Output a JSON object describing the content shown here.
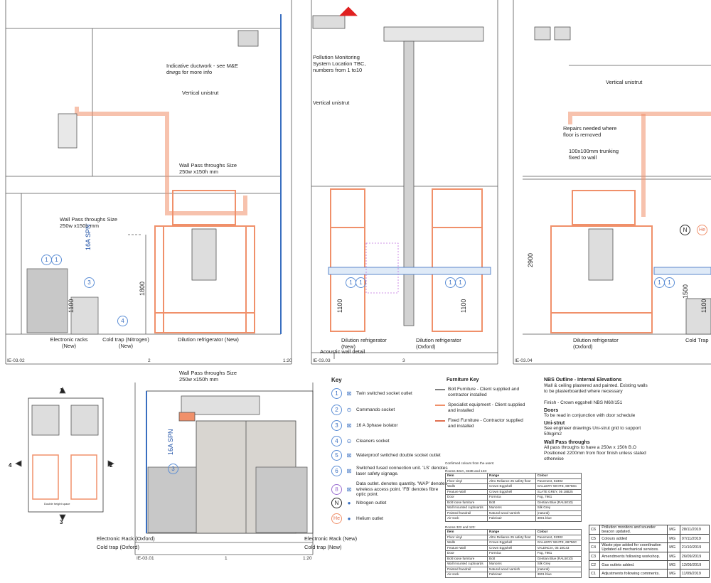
{
  "sheets": {
    "ie0302": {
      "ref": "IE-03.02",
      "num": "2",
      "scale": "1:20",
      "notes": {
        "ductwork": "Indicative ductwork - see M&E drwgs for more info",
        "unistrut": "Vertical unistrut",
        "wallpass_top": "Wall Pass throughs Size 250w x150h mm",
        "wallpass_left": "Wall Pass throughs Size 250w x150h mm"
      },
      "dims": {
        "d1100": "1100",
        "d1800": "1800"
      },
      "vlabel": "16A SPN",
      "labels": {
        "racks": "Electronic racks (New)",
        "coldtrap": "Cold trap (Nitrogen) (New)",
        "dilution": "Dilution refrigerator (New)"
      }
    },
    "ie0303": {
      "ref": "IE-03.03",
      "num": "3",
      "notes": {
        "pollution": "Pollution Monitoring System Location TBC, numbers from 1 to10",
        "unistrut": "Vertical unistrut"
      },
      "dims": {
        "d1100a": "1100",
        "d1100b": "1100"
      },
      "labels": {
        "dilution_new": "Dilution refrigerator (New)",
        "dilution_ox": "Dilution refrigerator (Oxford)",
        "acoustic": "Acoustic wall detail"
      }
    },
    "ie0304": {
      "ref": "IE-03.04",
      "notes": {
        "unistrut": "Vertical unistrut",
        "repairs": "Repairs needed where floor is removed",
        "trunking": "100x100mm trunking fixed to wall"
      },
      "dims": {
        "d2900": "2900",
        "d1500": "1500",
        "d1100": "1100"
      },
      "labels": {
        "dilution_ox": "Dilution refrigerator (Oxford)",
        "coldtrap": "Cold Trap"
      }
    },
    "ie0301": {
      "ref": "IE-03.01",
      "num": "1",
      "scale": "1:20",
      "notes": {
        "wallpass": "Wall Pass throughs Size 250w x150h mm"
      },
      "vlabel": "16A SPN",
      "labels": {
        "rack_ox": "Electronic Rack (Oxford)",
        "coldtrap_ox": "Cold trap (Oxford)",
        "rack_new": "Electronic Rack (New)",
        "coldtrap_new": "Cold trap (New)"
      }
    },
    "keyplan": {
      "n1": "1",
      "n2": "2",
      "n3": "3",
      "n4": "4",
      "hint": "Double height space"
    }
  },
  "key": {
    "title": "Key",
    "items": [
      {
        "num": "1",
        "sym": "⊠",
        "label": "Twin switched socket outlet"
      },
      {
        "num": "2",
        "sym": "⊙",
        "label": "Commando socket"
      },
      {
        "num": "3",
        "sym": "⊠",
        "label": "16 A 3phase isolator"
      },
      {
        "num": "4",
        "sym": "⊙",
        "label": "Cleaners socket"
      },
      {
        "num": "5",
        "sym": "⊠",
        "label": "Waterproof switched double socket outlet"
      },
      {
        "num": "6",
        "sym": "⊠",
        "label": "Switched fused connection unit. 'LS' denotes laser safety signage."
      },
      {
        "num": "8",
        "sym": "⊠",
        "label": "Data outlet. denotes quantity. 'WAP' denotes wireless access point. 'FB' denotes fibre optic point."
      },
      {
        "num": "N",
        "sym": "●",
        "label": "Nitrogen outlet"
      },
      {
        "num": "He",
        "sym": "●",
        "label": "Helium outlet"
      }
    ]
  },
  "furniture_key": {
    "title": "Furniture Key",
    "items": [
      {
        "label": "Bolt Furniture - Client supplied and contractor installed"
      },
      {
        "label": "Specialist equipment - Client supplied and installed"
      },
      {
        "label": "Fixed Furniture - Contractor supplied and installed"
      }
    ]
  },
  "nbs": {
    "title": "NBS Outline - Internal Elevations",
    "body": "Wall & ceiling plastered and painted. Existing walls to be plasterboarded where necessary",
    "finish": "Finish - Crown eggshell NBS M60/151",
    "doors_title": "Doors",
    "doors_body": "To be read in conjunction with door schedule",
    "unistrut_title": "Uni-strut",
    "unistrut_body": "See engineer drawings Uni-strut grid to support 50kg/m2",
    "wallpass_title": "Wall Pass throughs",
    "wallpass_body": "All pass throughs to have a 250w x 150h B.O Positioned 2200mm from floor finish unless stated otherwise"
  },
  "colours": {
    "intro": "Confirmed colours from the users:",
    "table1_title": "Rooms 322A, 322B and 123:",
    "table2_title": "Rooms 322 and 123:",
    "headers": [
      "Item",
      "Range",
      "Colour"
    ],
    "rows1": [
      [
        "Floor vinyl",
        "Altro Reliance 25 safety floor",
        "Pavement, 02302"
      ],
      [
        "Walls",
        "Crown Eggshell",
        "GALLERY WHITE, 69756C"
      ],
      [
        "Feature Wall",
        "Crown Eggshell",
        "SLATE GREY, 05 18B25"
      ],
      [
        "Door",
        "Formica",
        "Fog, 7961"
      ],
      [
        "Bolt loose furniture",
        "Bott",
        "Gentian Blue (RAL5010)"
      ],
      [
        "Wall mounted cupboards",
        "Manoms",
        "Silk Grey"
      ],
      [
        "Painted handrail",
        "Natural wood varnish",
        "(natural)"
      ],
      [
        "Air-sock",
        "Fabricair",
        "3001 blue"
      ]
    ],
    "rows2": [
      [
        "Floor vinyl",
        "Altro Reliance 25 safety floor",
        "Pavement, 02302"
      ],
      [
        "Walls",
        "Crown Eggshell",
        "GALLERY WHITE, 69756C"
      ],
      [
        "Feature Wall",
        "Crown Eggshell",
        "VALENCIA, 05 18C43"
      ],
      [
        "Door",
        "Formica",
        "Fog, 7961"
      ],
      [
        "Bolt loose furniture",
        "Bott",
        "Gentian Blue (RAL5010)"
      ],
      [
        "Wall mounted cupboards",
        "Manoms",
        "Silk Grey"
      ],
      [
        "Painted handrail",
        "Natural wood varnish",
        "(natural)"
      ],
      [
        "Air-sock",
        "Fabricair",
        "3001 blue"
      ]
    ]
  },
  "revisions": [
    {
      "rev": "C6",
      "desc": "Pollution monitors and sounder beacon updated.",
      "by": "MG",
      "date": "28/11/2019"
    },
    {
      "rev": "C5",
      "desc": "Colours added",
      "by": "MG",
      "date": "07/11/2019"
    },
    {
      "rev": "C4",
      "desc": "Waste pipe added for coordination Updated all mechanical services.",
      "by": "MG",
      "date": "21/10/2019"
    },
    {
      "rev": "C3",
      "desc": "Amendments following workshop.",
      "by": "MG",
      "date": "26/09/2019"
    },
    {
      "rev": "C2",
      "desc": "Gas outlets added.",
      "by": "MG",
      "date": "12/09/2019"
    },
    {
      "rev": "C1",
      "desc": "Adjustments following comments.",
      "by": "MG",
      "date": "11/09/2019"
    }
  ],
  "colors": {
    "orange": "#f0906a",
    "blue": "#3a6fc0",
    "purple": "#9b6fd1",
    "line": "#444444"
  }
}
